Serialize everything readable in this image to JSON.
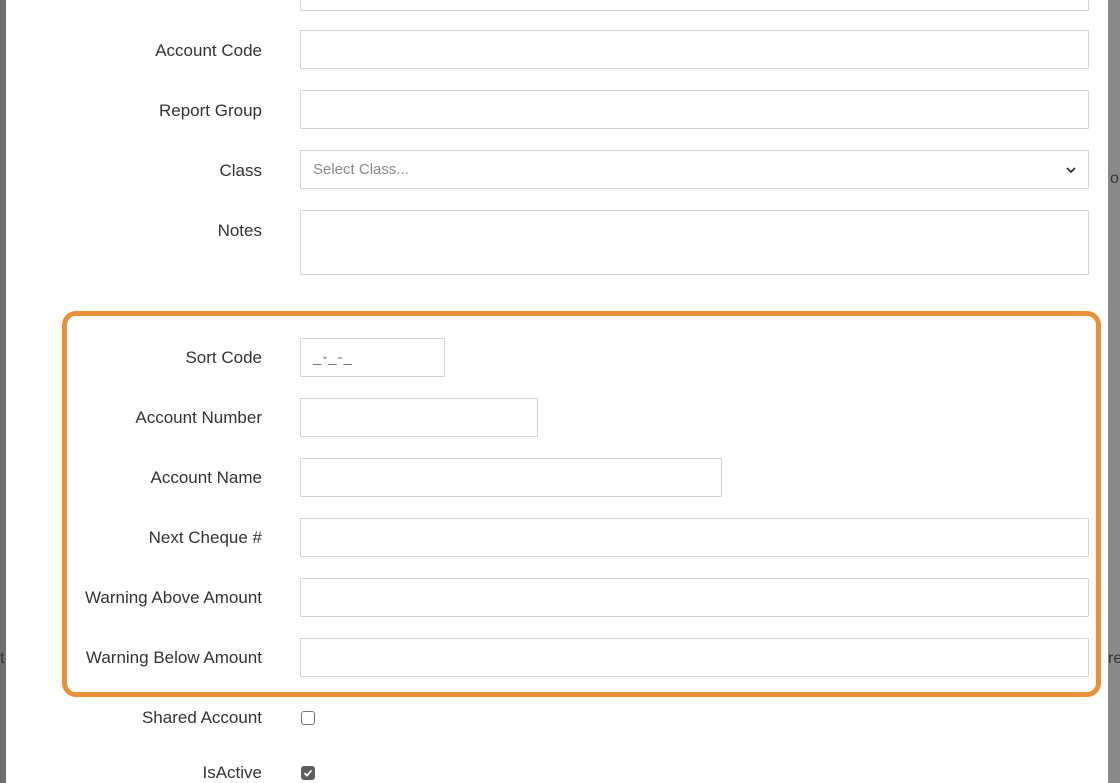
{
  "background": {
    "right_text_1": "o",
    "right_text_2": "re",
    "left_text_1": "t"
  },
  "form": {
    "account_code": {
      "label": "Account Code",
      "value": ""
    },
    "report_group": {
      "label": "Report Group",
      "value": ""
    },
    "class": {
      "label": "Class",
      "selected": "Select Class..."
    },
    "notes": {
      "label": "Notes",
      "value": ""
    },
    "sort_code": {
      "label": "Sort Code",
      "placeholder": "_-_-_"
    },
    "account_number": {
      "label": "Account Number",
      "value": ""
    },
    "account_name": {
      "label": "Account Name",
      "value": ""
    },
    "next_cheque": {
      "label": "Next Cheque #",
      "value": ""
    },
    "warning_above": {
      "label": "Warning Above Amount",
      "value": ""
    },
    "warning_below": {
      "label": "Warning Below Amount",
      "value": ""
    },
    "shared_account": {
      "label": "Shared Account",
      "checked": false
    },
    "is_active": {
      "label": "IsActive",
      "checked": true
    }
  },
  "colors": {
    "highlight": "#e8913a",
    "checkbox_checked": "#5f5f5f"
  }
}
